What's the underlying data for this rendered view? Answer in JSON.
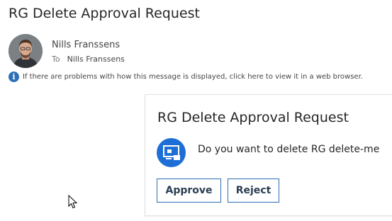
{
  "email": {
    "subject": "RG Delete Approval Request",
    "sender_name": "Nills Franssens",
    "to_label": "To",
    "to_name": "Nills Franssens",
    "info_message": "If there are problems with how this message is displayed, click here to view it in a web browser."
  },
  "card": {
    "title": "RG Delete Approval Request",
    "question": "Do you want to delete RG delete-me",
    "approve_label": "Approve",
    "reject_label": "Reject"
  },
  "icons": {
    "info": "info-icon",
    "flow": "power-automate-icon",
    "avatar": "user-avatar",
    "cursor": "mouse-pointer"
  },
  "colors": {
    "accent": "#2d6db2",
    "flow_icon_bg": "#1d6fd5",
    "info_icon_bg": "#2e6fb6"
  }
}
